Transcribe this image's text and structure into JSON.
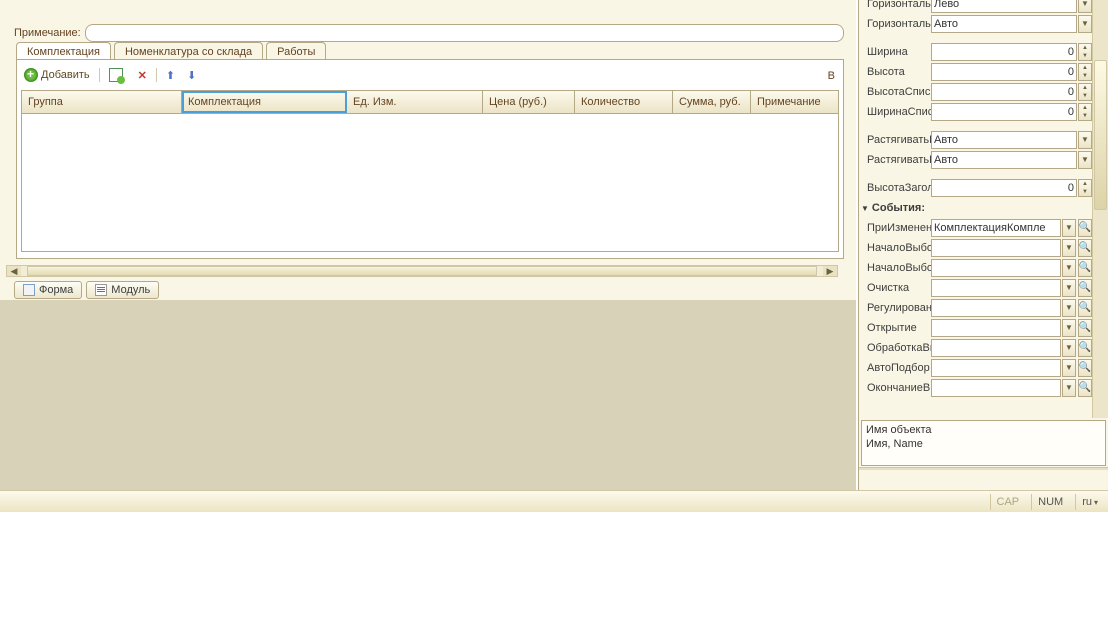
{
  "note": {
    "label": "Примечание:"
  },
  "tabs": [
    {
      "label": "Комплектация",
      "active": true
    },
    {
      "label": "Номенклатура со склада",
      "active": false
    },
    {
      "label": "Работы",
      "active": false
    }
  ],
  "toolbar": {
    "add": "Добавить",
    "right": "В"
  },
  "grid": {
    "columns": [
      "Группа",
      "Комплектация",
      "Ед. Изм.",
      "Цена (руб.)",
      "Количество",
      "Сумма, руб.",
      "Примечание"
    ]
  },
  "bottomTabs": {
    "form": "Форма",
    "module": "Модуль"
  },
  "props": {
    "hpos1": {
      "label": "Горизонтальн",
      "value": "Лево"
    },
    "hpos2": {
      "label": "Горизонтальн",
      "value": "Авто"
    },
    "width": {
      "label": "Ширина",
      "value": "0"
    },
    "height": {
      "label": "Высота",
      "value": "0"
    },
    "heightList": {
      "label": "ВысотаСписк",
      "value": "0"
    },
    "widthList": {
      "label": "ШиринаСписк",
      "value": "0"
    },
    "stretch1": {
      "label": "РастягиватьГ",
      "value": "Авто"
    },
    "stretch2": {
      "label": "РастягиватьГ",
      "value": "Авто"
    },
    "headerH": {
      "label": "ВысотаЗагол",
      "value": "0"
    },
    "events": {
      "title": "События:"
    },
    "ev_onChange": {
      "label": "ПриИзменени",
      "value": "КомплектацияКомпле"
    },
    "ev_startSel": {
      "label": "НачалоВыбор",
      "value": ""
    },
    "ev_startSel2": {
      "label": "НачалоВыбор",
      "value": ""
    },
    "ev_clear": {
      "label": "Очистка",
      "value": ""
    },
    "ev_regul": {
      "label": "Регулировани",
      "value": ""
    },
    "ev_open": {
      "label": "Открытие",
      "value": ""
    },
    "ev_procSel": {
      "label": "ОбработкаВы",
      "value": ""
    },
    "ev_autoPick": {
      "label": "АвтоПодбор",
      "value": ""
    },
    "ev_endInput": {
      "label": "ОкончаниеВв",
      "value": ""
    }
  },
  "hint": {
    "line1": "Имя объекта",
    "line2": "Имя, Name"
  },
  "status": {
    "cap": "CAP",
    "num": "NUM",
    "lang": "ru"
  }
}
